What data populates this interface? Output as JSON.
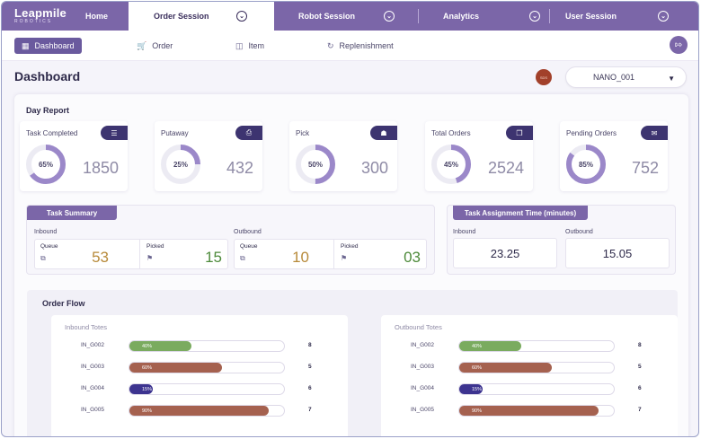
{
  "logo": {
    "line1": "Leapmile",
    "line2": "ROBOTICS"
  },
  "topnav": {
    "home": "Home",
    "order_session": "Order Session",
    "robot_session": "Robot Session",
    "analytics": "Analytics",
    "user_session": "User Session"
  },
  "subnav": {
    "dashboard": "Dashboard",
    "order": "Order",
    "item": "Item",
    "replenishment": "Replenishment"
  },
  "page": {
    "title": "Dashboard",
    "avatar_text": "SDS",
    "robot_select": "NANO_001"
  },
  "day_report": {
    "title": "Day Report",
    "kpis": [
      {
        "label": "Task Completed",
        "percent": 65,
        "percent_label": "65%",
        "value": "1850",
        "icon": "checklist-icon"
      },
      {
        "label": "Putaway",
        "percent": 25,
        "percent_label": "25%",
        "value": "432",
        "icon": "document-icon"
      },
      {
        "label": "Pick",
        "percent": 50,
        "percent_label": "50%",
        "value": "300",
        "icon": "tray-icon"
      },
      {
        "label": "Total Orders",
        "percent": 45,
        "percent_label": "45%",
        "value": "2524",
        "icon": "clipboard-icon"
      },
      {
        "label": "Pending Orders",
        "percent": 85,
        "percent_label": "85%",
        "value": "752",
        "icon": "pending-icon"
      }
    ]
  },
  "task_summary": {
    "title": "Task Summary",
    "inbound": {
      "label": "Inbound",
      "queue_label": "Queue",
      "queue": "53",
      "picked_label": "Picked",
      "picked": "15"
    },
    "outbound": {
      "label": "Outbound",
      "queue_label": "Queue",
      "queue": "10",
      "picked_label": "Picked",
      "picked": "03"
    }
  },
  "task_assignment": {
    "title": "Task Assignment Time (minutes)",
    "inbound_label": "Inbound",
    "inbound": "23.25",
    "outbound_label": "Outbound",
    "outbound": "15.05"
  },
  "order_flow": {
    "title": "Order Flow",
    "inbound": {
      "title": "Inbound Totes",
      "rows": [
        {
          "name": "IN_G002",
          "percent": 40,
          "percent_label": "40%",
          "count": "8",
          "color": "#7aab5f"
        },
        {
          "name": "IN_G003",
          "percent": 60,
          "percent_label": "60%",
          "count": "5",
          "color": "#a5614f"
        },
        {
          "name": "IN_G004",
          "percent": 15,
          "percent_label": "15%",
          "count": "6",
          "color": "#3d3490"
        },
        {
          "name": "IN_G005",
          "percent": 90,
          "percent_label": "90%",
          "count": "7",
          "color": "#a5614f"
        }
      ]
    },
    "outbound": {
      "title": "Outbound Totes",
      "rows": [
        {
          "name": "IN_G002",
          "percent": 40,
          "percent_label": "40%",
          "count": "8",
          "color": "#7aab5f"
        },
        {
          "name": "IN_G003",
          "percent": 60,
          "percent_label": "60%",
          "count": "5",
          "color": "#a5614f"
        },
        {
          "name": "IN_G004",
          "percent": 15,
          "percent_label": "15%",
          "count": "6",
          "color": "#3d3490"
        },
        {
          "name": "IN_G005",
          "percent": 90,
          "percent_label": "90%",
          "count": "7",
          "color": "#a5614f"
        }
      ]
    }
  },
  "colors": {
    "brand": "#7b66a8",
    "ring": "#9b88c9",
    "ring_track": "#ecebf3",
    "queue": "#b78a3a",
    "picked": "#4d8a3a"
  }
}
